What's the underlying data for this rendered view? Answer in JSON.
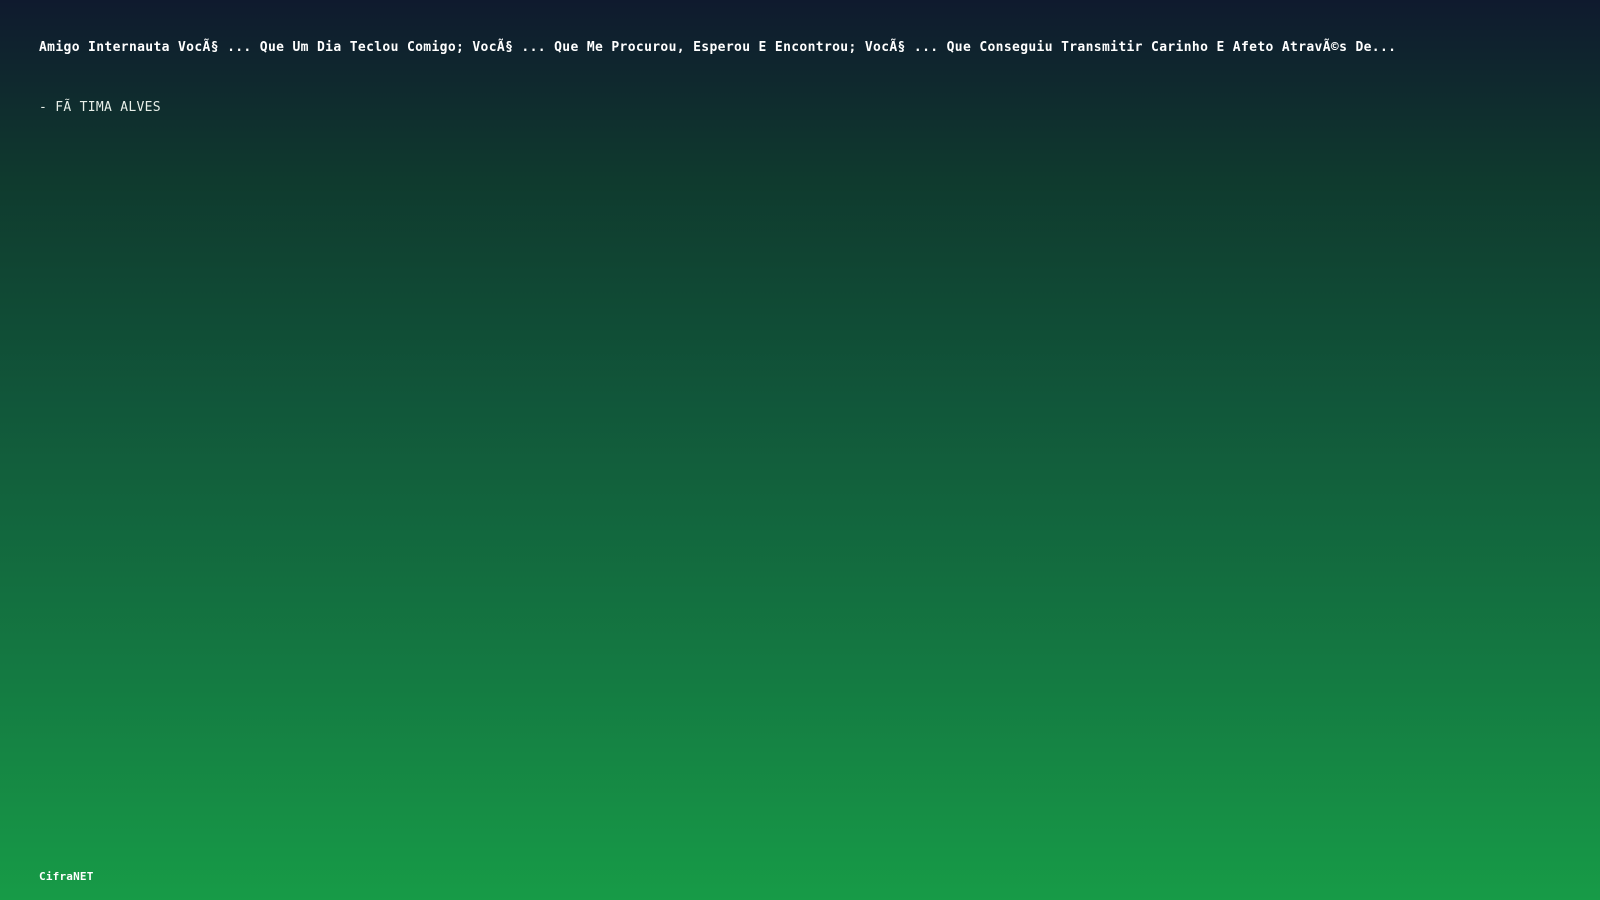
{
  "quote": {
    "text": "Amigo Internauta VocÃ§ ... Que Um Dia Teclou Comigo; VocÃ§ ... Que Me Procurou, Esperou E Encontrou; VocÃ§ ... Que Conseguiu Transmitir Carinho E Afeto AtravÃ©s De..."
  },
  "author": {
    "text": "- FÃ TIMA ALVES"
  },
  "brand": {
    "name": "CifraNET"
  },
  "colors": {
    "gradient_top": "#0f1a2e",
    "gradient_bottom": "#179b47",
    "text": "#ffffff"
  }
}
